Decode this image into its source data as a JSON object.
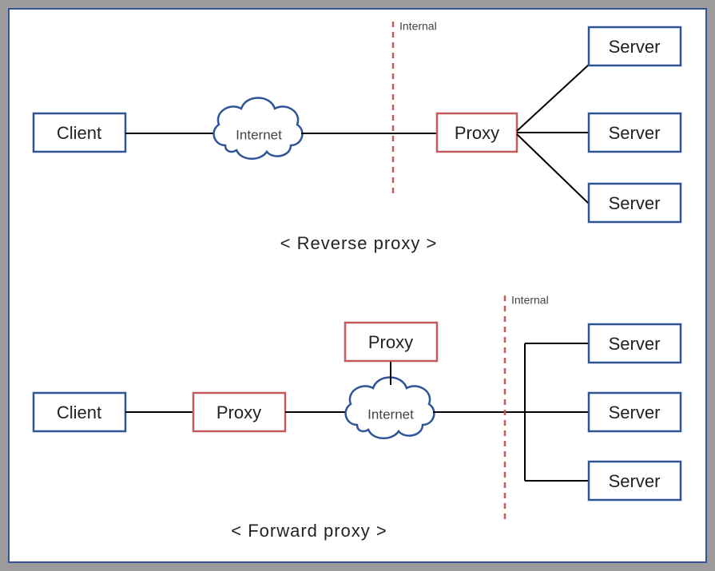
{
  "colors": {
    "blue": "#2f5597",
    "red": "#c55a5a",
    "line": "#000000",
    "dash": "#c55a5a"
  },
  "reverse": {
    "client": "Client",
    "internet": "Internet",
    "proxy": "Proxy",
    "server1": "Server",
    "server2": "Server",
    "server3": "Server",
    "internal": "Internal",
    "caption": "< Reverse proxy >"
  },
  "forward": {
    "client": "Client",
    "proxy1": "Proxy",
    "proxy2": "Proxy",
    "internet": "Internet",
    "server1": "Server",
    "server2": "Server",
    "server3": "Server",
    "internal": "Internal",
    "caption": "< Forward proxy >"
  }
}
